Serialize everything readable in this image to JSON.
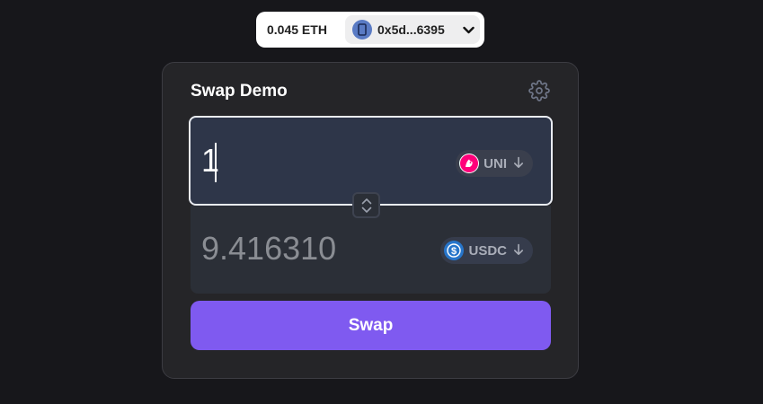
{
  "wallet": {
    "balance": "0.045 ETH",
    "address": "0x5d...6395",
    "chevron": "❯"
  },
  "card": {
    "title": "Swap Demo",
    "settings_icon": "gear-icon"
  },
  "input": {
    "amount": "1",
    "token": "UNI",
    "token_icon": "uni-logo-icon",
    "token_color": "#ff007a"
  },
  "output": {
    "amount": "9.416310",
    "token": "USDC",
    "token_icon": "usdc-logo-icon",
    "token_color": "#2775ca"
  },
  "actions": {
    "swap_label": "Swap",
    "accent": "#7f5af0"
  }
}
